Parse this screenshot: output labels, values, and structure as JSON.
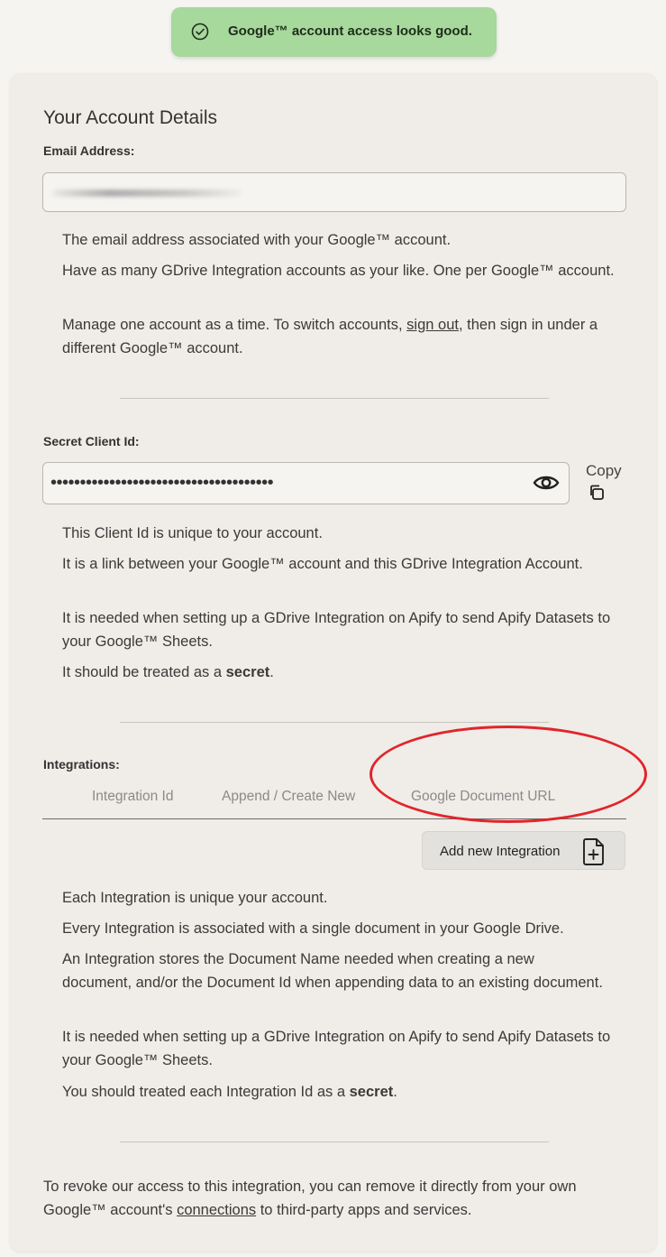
{
  "toast": {
    "message": "Google™ account access looks good.",
    "icon": "check-circle-icon"
  },
  "account": {
    "title": "Your Account Details",
    "email_label": "Email Address:",
    "email_value": "",
    "email_help": [
      "The email address associated with your Google™ account.",
      "Have as many GDrive Integration accounts as your like. One per Google™ account."
    ],
    "switch_text_before": "Manage one account as a time. To switch accounts, ",
    "sign_out_link": "sign out",
    "switch_text_after": ", then sign in under a different Google™ account."
  },
  "client": {
    "label": "Secret Client Id:",
    "masked_value": "••••••••••••••••••••••••••••••••••••••",
    "copy_label": "Copy",
    "help": [
      "This Client Id is unique to your account.",
      "It is a link between your Google™ account and this GDrive Integration Account.",
      "It is needed when setting up a GDrive Integration on Apify to send Apify Datasets to your Google™ Sheets."
    ],
    "secret_before": "It should be treated as a ",
    "secret_word": "secret",
    "secret_after": "."
  },
  "integrations": {
    "label": "Integrations:",
    "columns": [
      "Integration Id",
      "Append / Create New",
      "Google Document URL"
    ],
    "add_button": "Add new Integration",
    "help": [
      "Each Integration is unique your account.",
      "Every Integration is associated with a single document in your Google Drive.",
      "An Integration stores the Document Name needed when creating a new document, and/or the Document Id when appending data to an existing document.",
      "It is needed when setting up a GDrive Integration on Apify to send Apify Datasets to your Google™ Sheets."
    ],
    "secret_before": "You should treated each Integration Id as a ",
    "secret_word": "secret",
    "secret_after": "."
  },
  "footer": {
    "before": "To revoke our access to this integration, you can remove it directly from your own Google™ account's ",
    "link": "connections",
    "after": " to third-party apps and services."
  },
  "colors": {
    "toast_bg": "#a7d89c",
    "card_bg": "#f0ece7",
    "annotation": "#e0252b"
  }
}
